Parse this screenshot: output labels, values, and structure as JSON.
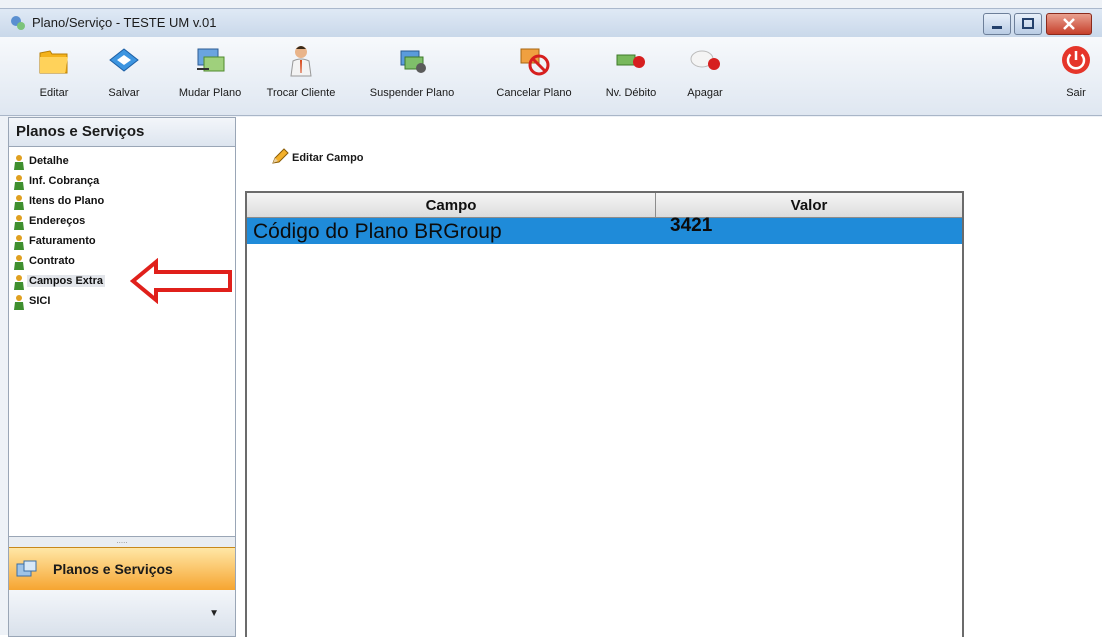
{
  "window": {
    "title": "Plano/Serviço - TESTE UM v.01"
  },
  "toolbar": {
    "items": [
      {
        "label": "Editar",
        "icon": "folder-edit-icon"
      },
      {
        "label": "Salvar",
        "icon": "save-diamond-icon"
      },
      {
        "label": "Mudar Plano",
        "icon": "change-plan-icon"
      },
      {
        "label": "Trocar Cliente",
        "icon": "person-icon"
      },
      {
        "label": "Suspender Plano",
        "icon": "suspend-icon"
      },
      {
        "label": "Cancelar Plano",
        "icon": "cancel-icon"
      },
      {
        "label": "Nv. Débito",
        "icon": "debit-icon"
      },
      {
        "label": "Apagar",
        "icon": "delete-icon"
      }
    ],
    "exit_label": "Sair"
  },
  "sidebar": {
    "title": "Planos e Serviços",
    "items": [
      {
        "label": "Detalhe"
      },
      {
        "label": "Inf. Cobrança"
      },
      {
        "label": "Itens do Plano"
      },
      {
        "label": "Endereços"
      },
      {
        "label": "Faturamento"
      },
      {
        "label": "Contrato"
      },
      {
        "label": "Campos Extra",
        "selected": true
      },
      {
        "label": "SICI"
      }
    ],
    "nav_button": "Planos e Serviços"
  },
  "main": {
    "edit_button": "Editar Campo",
    "grid": {
      "columns": [
        "Campo",
        "Valor"
      ],
      "rows": [
        {
          "campo": "Código do Plano BRGroup",
          "valor": "3421"
        }
      ]
    }
  },
  "colors": {
    "selection": "#1f8bd9",
    "annotation_arrow": "#e0201b",
    "nav_accent": "#f6a531"
  }
}
